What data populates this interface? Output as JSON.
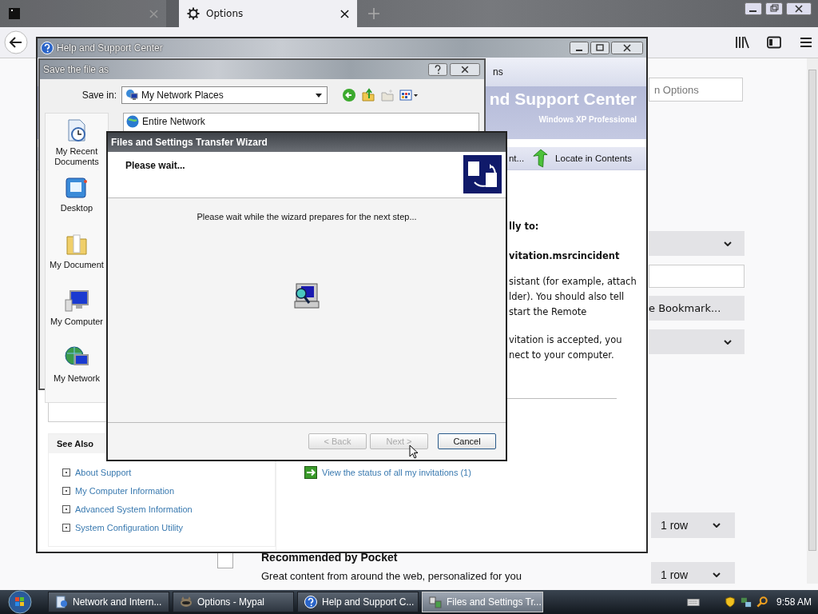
{
  "browser": {
    "tabs": [
      {
        "kind": "faded",
        "selected": false
      },
      {
        "kind": "settings",
        "label": "Options",
        "selected": true
      }
    ],
    "prefs": {
      "search_placeholder": "n Options",
      "bookmark_button": "e Bookmark...",
      "row_selects": [
        {
          "value": "1 row"
        },
        {
          "value": "1 row"
        }
      ],
      "pocket": {
        "title": "Recommended by Pocket",
        "checked": false,
        "description": "Great content from around the web, personalized for you"
      }
    }
  },
  "help_window": {
    "title": "Help and Support Center",
    "nav_text": "ns",
    "banner_title": "nd Support Center",
    "banner_subtitle": "Windows XP Professional",
    "toolbar": [
      {
        "kind": "text",
        "label": "nt..."
      },
      {
        "kind": "arrow",
        "label": "Locate in Contents"
      }
    ],
    "heading": "lly to:",
    "filename": "vitation.msrcincident",
    "paragraphs": [
      [
        "sistant (for example, attach",
        "lder). You should also tell",
        "start the Remote"
      ],
      [
        "vitation is accepted, you",
        "nect to your computer."
      ]
    ],
    "status_link": "View the status of all my invitations (1)",
    "see_also": {
      "title": "See Also",
      "links": [
        "About Support",
        "My Computer Information",
        "Advanced System Information",
        "System Configuration Utility"
      ]
    }
  },
  "save_dialog": {
    "title": "Save the file as",
    "save_in_label": "Save in:",
    "save_in_value": "My Network Places",
    "places": [
      {
        "kind": "recent",
        "label": "My Recent Documents"
      },
      {
        "kind": "desktop",
        "label": "Desktop"
      },
      {
        "kind": "documents",
        "label": "My Document"
      },
      {
        "kind": "computer",
        "label": "My Computer"
      },
      {
        "kind": "network",
        "label": "My Network"
      }
    ],
    "files": [
      {
        "name": "Entire Network"
      }
    ]
  },
  "wizard": {
    "title": "Files and Settings Transfer Wizard",
    "header": "Please wait...",
    "message": "Please wait while the wizard prepares for the next step...",
    "buttons": [
      {
        "label": "< Back",
        "disabled": true
      },
      {
        "label": "Next >",
        "disabled": true
      },
      {
        "label": "Cancel",
        "disabled": false
      }
    ]
  },
  "taskbar": {
    "tasks": [
      {
        "kind": "network",
        "label": "Network and Intern...",
        "selected": false
      },
      {
        "kind": "browser",
        "label": "Options - Mypal",
        "selected": false
      },
      {
        "kind": "help",
        "label": "Help and Support C...",
        "selected": false
      },
      {
        "kind": "wizard",
        "label": "Files and Settings Tr...",
        "selected": true
      }
    ],
    "clock": "9:58 AM"
  }
}
